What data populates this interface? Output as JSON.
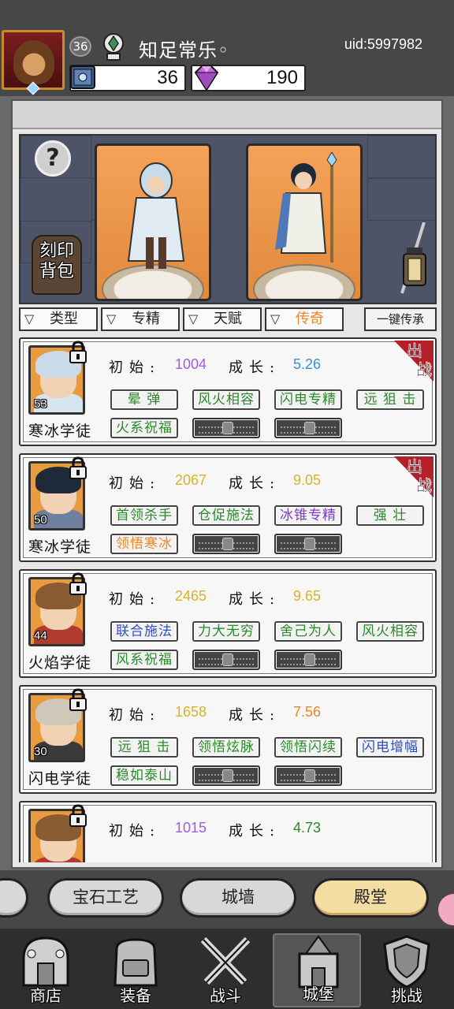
{
  "player": {
    "level": "36",
    "name": "知足常乐◦",
    "uid": "uid:5997982",
    "book_count": "36",
    "gem_count": "190"
  },
  "showcase": {
    "help_label": "?",
    "bag_label": "刻印背包"
  },
  "filters": [
    {
      "label": "类型",
      "active": false
    },
    {
      "label": "专精",
      "active": false
    },
    {
      "label": "天赋",
      "active": false
    },
    {
      "label": "传奇",
      "active": true
    },
    {
      "label": "一键传承",
      "active": false
    }
  ],
  "stat_labels": {
    "initial": "初始:",
    "growth": "成长:"
  },
  "characters": [
    {
      "name": "寒冰学徒",
      "level": "53",
      "deployed": true,
      "initial": "1004",
      "initial_color": "#a35be0",
      "growth": "5.26",
      "growth_color": "#3a8fd6",
      "skills": [
        {
          "label": "晕 弹",
          "color": "#2a8a2a"
        },
        {
          "label": "风火相容",
          "color": "#2a8a2a"
        },
        {
          "label": "闪电专精",
          "color": "#2a8a2a"
        },
        {
          "label": "远 狙 击",
          "color": "#2a8a2a"
        },
        {
          "label": "火系祝福",
          "color": "#2a8a2a"
        },
        {
          "label": "",
          "locked": true
        },
        {
          "label": "",
          "locked": true
        }
      ],
      "portrait": {
        "hair": "#c9dbe8",
        "body": "#d6e6f0",
        "bg": "#e99b3f"
      }
    },
    {
      "name": "寒冰学徒",
      "level": "50",
      "deployed": true,
      "initial": "2067",
      "initial_color": "#d9b327",
      "growth": "9.05",
      "growth_color": "#d9b327",
      "skills": [
        {
          "label": "首领杀手",
          "color": "#2a8a2a"
        },
        {
          "label": "仓促施法",
          "color": "#2a8a2a"
        },
        {
          "label": "冰锥专精",
          "color": "#7a3fc0"
        },
        {
          "label": "强 壮",
          "color": "#2a8a2a"
        },
        {
          "label": "领悟寒冰",
          "color": "#e8882a"
        },
        {
          "label": "",
          "locked": true
        },
        {
          "label": "",
          "locked": true
        }
      ],
      "portrait": {
        "hair": "#1e2a3a",
        "body": "#6e7fa0",
        "bg": "#e99b3f"
      }
    },
    {
      "name": "火焰学徒",
      "level": "44",
      "deployed": false,
      "initial": "2465",
      "initial_color": "#d9b327",
      "growth": "9.65",
      "growth_color": "#d9b327",
      "skills": [
        {
          "label": "联合施法",
          "color": "#2e4fbf"
        },
        {
          "label": "力大无穷",
          "color": "#2a8a2a"
        },
        {
          "label": "舍己为人",
          "color": "#2a8a2a"
        },
        {
          "label": "风火相容",
          "color": "#2a8a2a"
        },
        {
          "label": "风系祝福",
          "color": "#2a8a2a"
        },
        {
          "label": "",
          "locked": true
        },
        {
          "label": "",
          "locked": true
        }
      ],
      "portrait": {
        "hair": "#8a5a32",
        "body": "#b23a2e",
        "bg": "#e99b3f"
      }
    },
    {
      "name": "闪电学徒",
      "level": "30",
      "deployed": false,
      "initial": "1658",
      "initial_color": "#d9b327",
      "growth": "7.56",
      "growth_color": "#e8882a",
      "skills": [
        {
          "label": "远 狙 击",
          "color": "#2a8a2a"
        },
        {
          "label": "领悟炫脉",
          "color": "#2a8a2a"
        },
        {
          "label": "领悟闪续",
          "color": "#2a8a2a"
        },
        {
          "label": "闪电增幅",
          "color": "#2e4fbf"
        },
        {
          "label": "稳如泰山",
          "color": "#2a8a2a"
        },
        {
          "label": "",
          "locked": true
        },
        {
          "label": "",
          "locked": true
        }
      ],
      "portrait": {
        "hair": "#cfc7b8",
        "body": "#3a3a3a",
        "bg": "#e99b3f"
      }
    },
    {
      "name": "",
      "level": "",
      "deployed": false,
      "initial": "1015",
      "initial_color": "#a35be0",
      "growth": "4.73",
      "growth_color": "#2a8a2a",
      "skills": [],
      "portrait": {
        "hair": "#8a5a32",
        "body": "#b23a2e",
        "bg": "#e99b3f"
      }
    }
  ],
  "deploy_tag": "出战",
  "subtabs": [
    {
      "label": "宝石工艺",
      "active": false
    },
    {
      "label": "城墙",
      "active": false
    },
    {
      "label": "殿堂",
      "active": true
    }
  ],
  "nav": [
    {
      "label": "商店",
      "icon": "shop-icon",
      "active": false
    },
    {
      "label": "装备",
      "icon": "backpack-icon",
      "active": false
    },
    {
      "label": "战斗",
      "icon": "crossed-swords-icon",
      "active": false
    },
    {
      "label": "城堡",
      "icon": "castle-icon",
      "active": true
    },
    {
      "label": "挑战",
      "icon": "shield-icon",
      "active": false
    }
  ]
}
